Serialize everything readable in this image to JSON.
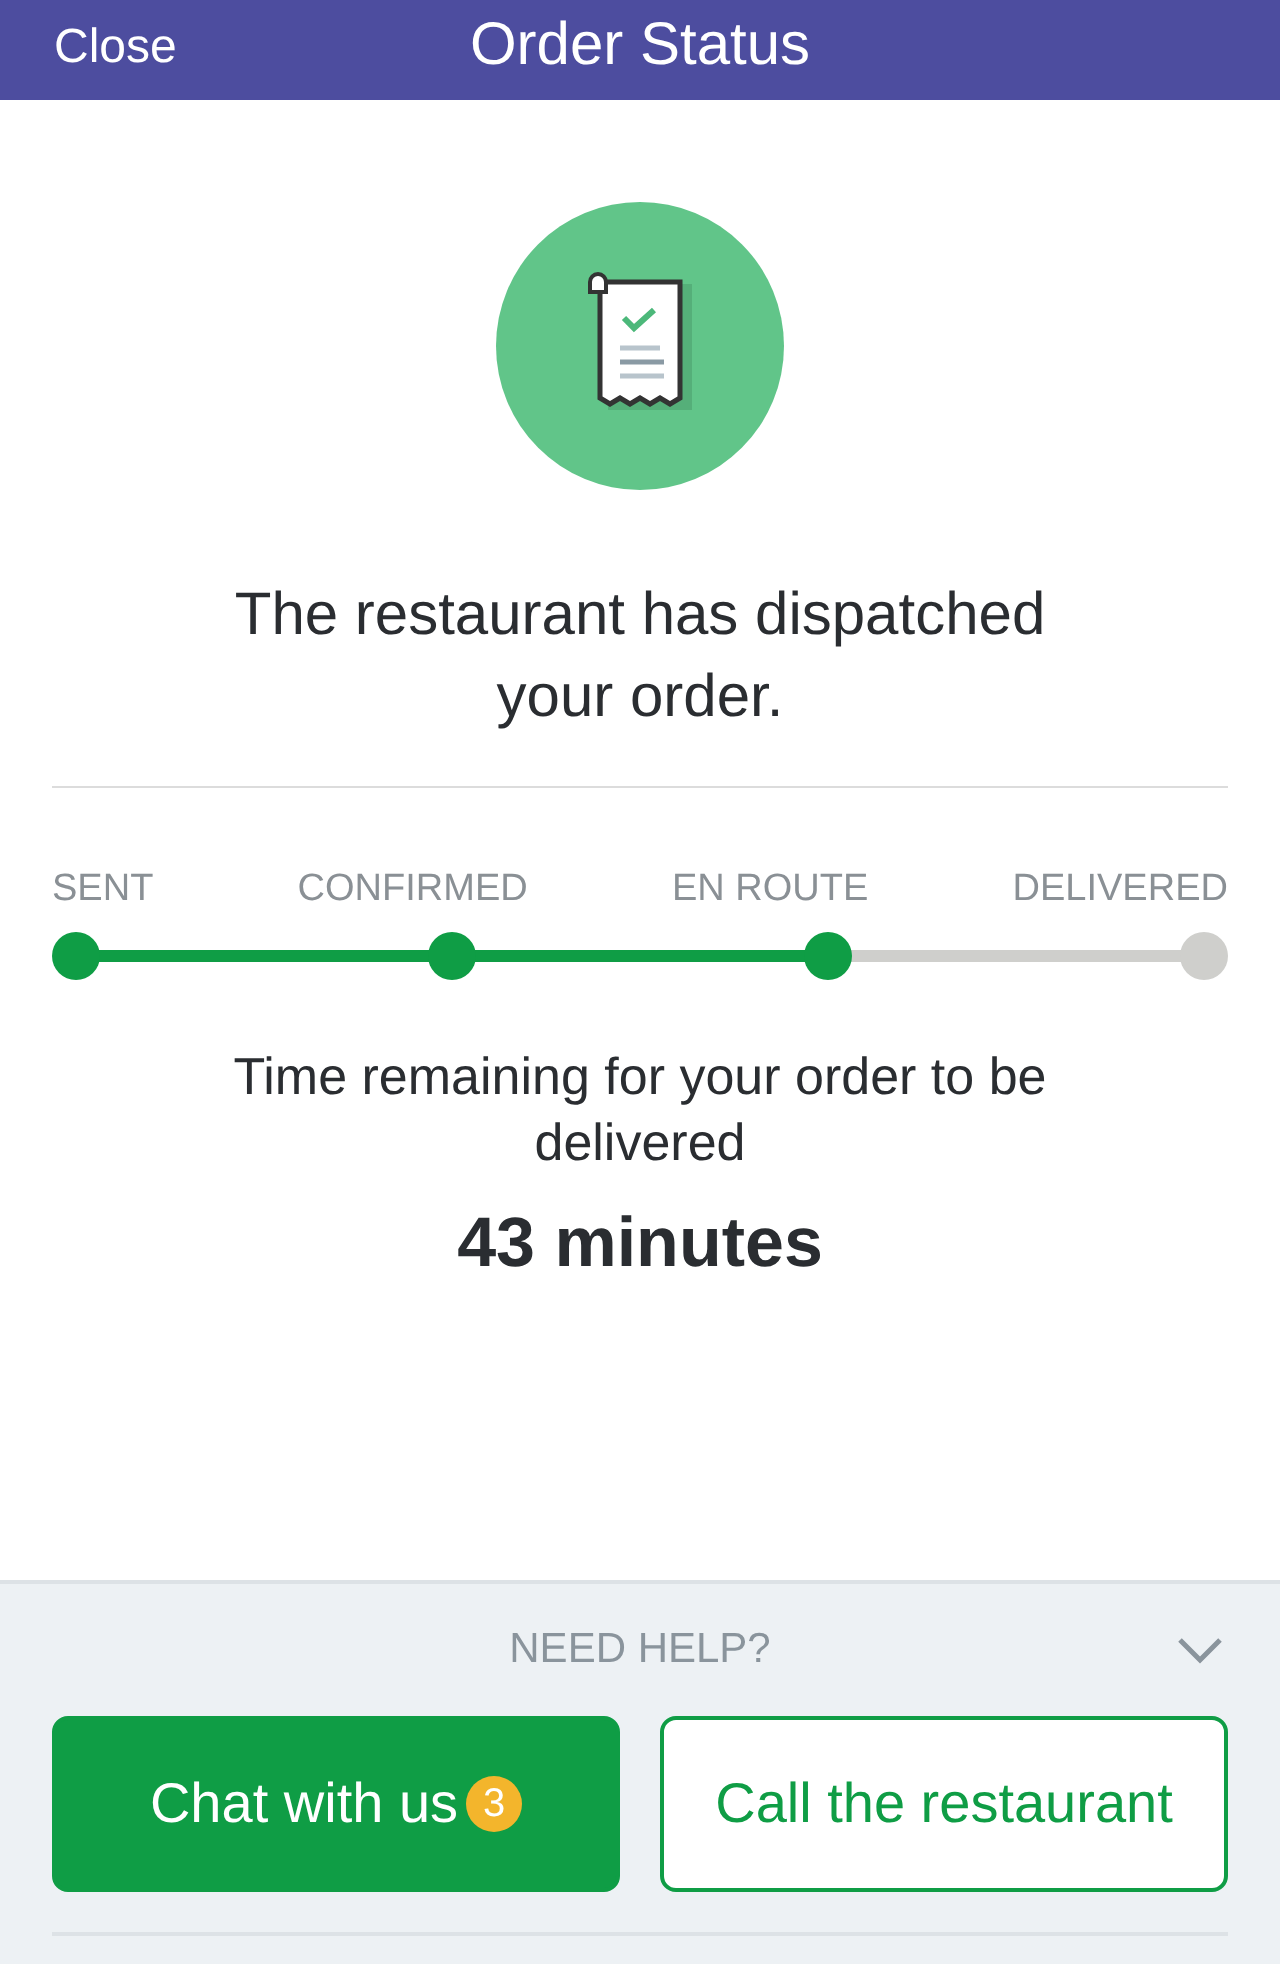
{
  "header": {
    "close": "Close",
    "title": "Order Status"
  },
  "status_message": "The restaurant has dispatched your order.",
  "steps": [
    {
      "label": "SENT",
      "done": true
    },
    {
      "label": "CONFIRMED",
      "done": true
    },
    {
      "label": "EN ROUTE",
      "done": true
    },
    {
      "label": "DELIVERED",
      "done": false
    }
  ],
  "time_label": "Time remaining for your order to be delivered",
  "time_value": "43 minutes",
  "help": {
    "title": "NEED HELP?",
    "expanded": true,
    "buttons": [
      {
        "label": "Chat with us",
        "kind": "primary",
        "badge": "3"
      },
      {
        "label": "Call the restaurant",
        "kind": "outline"
      }
    ]
  }
}
